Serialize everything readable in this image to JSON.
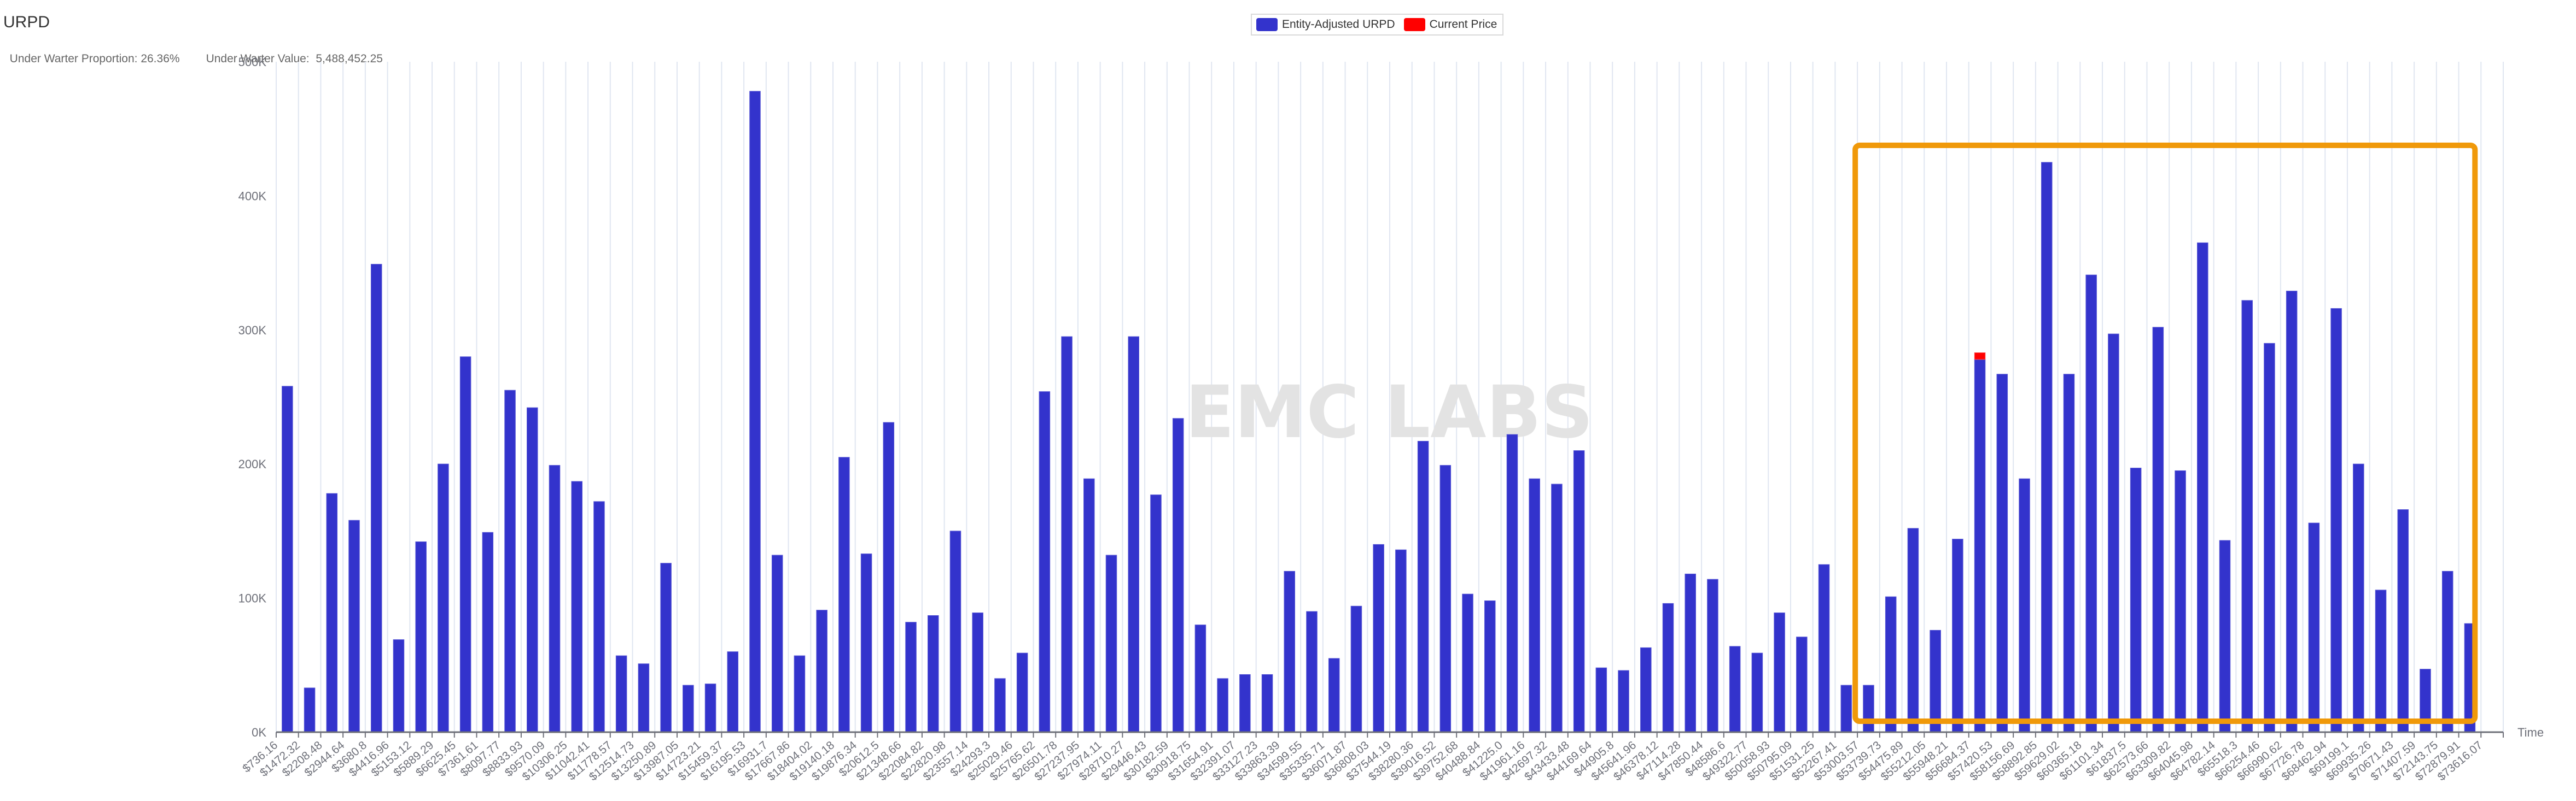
{
  "header": {
    "title": "URPD",
    "under_water_proportion_label": "Under Warter Proportion:",
    "under_water_proportion_value": "26.36%",
    "under_water_value_label": "Under Warter Value:",
    "under_water_value_value": "5,488,452.25"
  },
  "legend": {
    "items": [
      {
        "label": "Entity-Adjusted URPD",
        "color": "#3333cc",
        "icon": "legend-swatch"
      },
      {
        "label": "Current Price",
        "color": "#ff0000",
        "icon": "legend-swatch"
      }
    ]
  },
  "watermark": "EMC LABS",
  "highlight": {
    "color": "#f0990a",
    "from_category": "$53003.57",
    "to_category": "$72879.91"
  },
  "chart_data": {
    "type": "bar",
    "title": "URPD",
    "xlabel": "Time",
    "ylabel": "",
    "ylim": [
      0,
      500000
    ],
    "yticks": [
      0,
      100000,
      200000,
      300000,
      400000,
      500000
    ],
    "ytick_labels": [
      "0K",
      "100K",
      "200K",
      "300K",
      "400K",
      "500K"
    ],
    "grid": "vertical",
    "legend_position": "top-center",
    "stacked": true,
    "categories": [
      "$736.16",
      "$1472.32",
      "$2208.48",
      "$2944.64",
      "$3680.8",
      "$4416.96",
      "$5153.12",
      "$5889.29",
      "$6625.45",
      "$7361.61",
      "$8097.77",
      "$8833.93",
      "$9570.09",
      "$10306.25",
      "$11042.41",
      "$11778.57",
      "$12514.73",
      "$13250.89",
      "$13987.05",
      "$14723.21",
      "$15459.37",
      "$16195.53",
      "$16931.7",
      "$17667.86",
      "$18404.02",
      "$19140.18",
      "$19876.34",
      "$20612.5",
      "$21348.66",
      "$22084.82",
      "$22820.98",
      "$23557.14",
      "$24293.3",
      "$25029.46",
      "$25765.62",
      "$26501.78",
      "$27237.95",
      "$27974.11",
      "$28710.27",
      "$29446.43",
      "$30182.59",
      "$30918.75",
      "$31654.91",
      "$32391.07",
      "$33127.23",
      "$33863.39",
      "$34599.55",
      "$35335.71",
      "$36071.87",
      "$36808.03",
      "$37544.19",
      "$38280.36",
      "$39016.52",
      "$39752.68",
      "$40488.84",
      "$41225.0",
      "$41961.16",
      "$42697.32",
      "$43433.48",
      "$44169.64",
      "$44905.8",
      "$45641.96",
      "$46378.12",
      "$47114.28",
      "$47850.44",
      "$48586.6",
      "$49322.77",
      "$50058.93",
      "$50795.09",
      "$51531.25",
      "$52267.41",
      "$53003.57",
      "$53739.73",
      "$54475.89",
      "$55212.05",
      "$55948.21",
      "$56684.37",
      "$57420.53",
      "$58156.69",
      "$58892.85",
      "$59629.02",
      "$60365.18",
      "$61101.34",
      "$61837.5",
      "$62573.66",
      "$63309.82",
      "$64045.98",
      "$64782.14",
      "$65518.3",
      "$66254.46",
      "$66990.62",
      "$67726.78",
      "$68462.94",
      "$69199.1",
      "$69935.26",
      "$70671.43",
      "$71407.59",
      "$72143.75",
      "$72879.91",
      "$73616.07"
    ],
    "series": [
      {
        "name": "Entity-Adjusted URPD",
        "color": "#3333cc",
        "values": [
          258000,
          33000,
          178000,
          158000,
          349000,
          69000,
          142000,
          200000,
          280000,
          149000,
          255000,
          242000,
          199000,
          187000,
          172000,
          57000,
          51000,
          126000,
          35000,
          36000,
          60000,
          478000,
          132000,
          57000,
          91000,
          205000,
          133000,
          231000,
          82000,
          87000,
          150000,
          89000,
          40000,
          59000,
          254000,
          295000,
          189000,
          132000,
          295000,
          177000,
          234000,
          80000,
          40000,
          43000,
          43000,
          120000,
          90000,
          55000,
          94000,
          140000,
          136000,
          217000,
          199000,
          103000,
          98000,
          222000,
          189000,
          185000,
          210000,
          48000,
          46000,
          63000,
          96000,
          118000,
          114000,
          64000,
          59000,
          89000,
          71000,
          125000,
          35000,
          35000,
          101000,
          152000,
          76000,
          144000,
          278000,
          267000,
          189000,
          425000,
          267000,
          341000,
          297000,
          197000,
          302000,
          195000,
          365000,
          143000,
          322000,
          290000,
          329000,
          156000,
          316000,
          200000,
          106000,
          166000,
          47000,
          120000,
          81000,
          0
        ]
      },
      {
        "name": "Current Price",
        "color": "#ff0000",
        "values": [
          0,
          0,
          0,
          0,
          0,
          0,
          0,
          0,
          0,
          0,
          0,
          0,
          0,
          0,
          0,
          0,
          0,
          0,
          0,
          0,
          0,
          0,
          0,
          0,
          0,
          0,
          0,
          0,
          0,
          0,
          0,
          0,
          0,
          0,
          0,
          0,
          0,
          0,
          0,
          0,
          0,
          0,
          0,
          0,
          0,
          0,
          0,
          0,
          0,
          0,
          0,
          0,
          0,
          0,
          0,
          0,
          0,
          0,
          0,
          0,
          0,
          0,
          0,
          0,
          0,
          0,
          0,
          0,
          0,
          0,
          0,
          0,
          0,
          0,
          0,
          0,
          5000,
          0,
          0,
          0,
          0,
          0,
          0,
          0,
          0,
          0,
          0,
          0,
          0,
          0,
          0,
          0,
          0,
          0,
          0,
          0,
          0,
          0,
          0,
          0
        ]
      }
    ]
  }
}
